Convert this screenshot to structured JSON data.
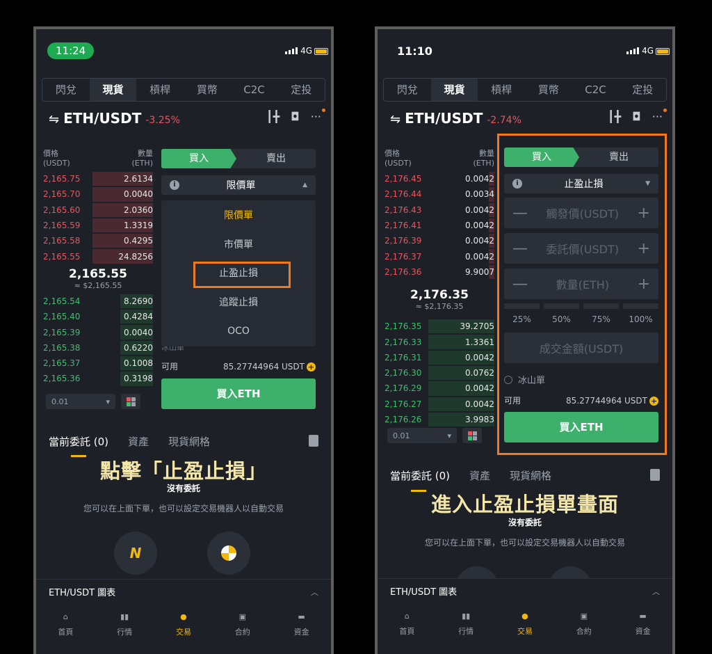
{
  "left": {
    "time": "11:24",
    "network": "4G",
    "tabs": [
      "閃兌",
      "現貨",
      "槓桿",
      "買幣",
      "C2C",
      "定投"
    ],
    "active_tab": 1,
    "pair": "ETH/USDT",
    "change": "-3.25%",
    "orderbook_header": {
      "price": "價格",
      "price_unit": "(USDT)",
      "qty": "數量",
      "qty_unit": "(ETH)"
    },
    "asks": [
      {
        "price": "2,165.75",
        "qty": "2.6134",
        "depth": 0.55
      },
      {
        "price": "2,165.70",
        "qty": "0.0040",
        "depth": 0.55
      },
      {
        "price": "2,165.60",
        "qty": "2.0360",
        "depth": 0.55
      },
      {
        "price": "2,165.59",
        "qty": "1.3319",
        "depth": 0.55
      },
      {
        "price": "2,165.58",
        "qty": "0.4295",
        "depth": 0.55
      },
      {
        "price": "2,165.55",
        "qty": "24.8256",
        "depth": 0.55
      }
    ],
    "last_price": "2,165.55",
    "last_price_usd": "≈ $2,165.55",
    "bids": [
      {
        "price": "2,165.54",
        "qty": "8.2690",
        "depth": 0.3
      },
      {
        "price": "2,165.40",
        "qty": "0.4284",
        "depth": 0.3
      },
      {
        "price": "2,165.39",
        "qty": "0.0040",
        "depth": 0.3
      },
      {
        "price": "2,165.38",
        "qty": "0.6220",
        "depth": 0.3
      },
      {
        "price": "2,165.37",
        "qty": "0.1008",
        "depth": 0.3
      },
      {
        "price": "2,165.36",
        "qty": "0.3198",
        "depth": 0.3
      }
    ],
    "precision": "0.01",
    "buy_label": "買入",
    "sell_label": "賣出",
    "order_type": "限價單",
    "dropdown": [
      "限價單",
      "市價單",
      "止盈止損",
      "追蹤止損",
      "OCO"
    ],
    "partial_text": "冰山單",
    "available_label": "可用",
    "available_value": "85.27744964 USDT",
    "buy_button": "買入ETH",
    "bottom_tabs": [
      "當前委託 (0)",
      "資產",
      "現貨網格"
    ],
    "caption": "點擊「止盈止損」",
    "no_orders": "沒有委託",
    "hint": "您可以在上面下單，也可以設定交易機器人以自動交易",
    "chart_label": "ETH/USDT 圖表",
    "nav": [
      "首頁",
      "行情",
      "交易",
      "合約",
      "資金"
    ],
    "nav_active": 2
  },
  "right": {
    "time": "11:10",
    "network": "4G",
    "tabs": [
      "閃兌",
      "現貨",
      "槓桿",
      "買幣",
      "C2C",
      "定投"
    ],
    "active_tab": 1,
    "pair": "ETH/USDT",
    "change": "-2.74%",
    "orderbook_header": {
      "price": "價格",
      "price_unit": "(USDT)",
      "qty": "數量",
      "qty_unit": "(ETH)"
    },
    "asks": [
      {
        "price": "2,176.45",
        "qty": "0.0042",
        "depth": 0.05
      },
      {
        "price": "2,176.44",
        "qty": "0.0034",
        "depth": 0.05
      },
      {
        "price": "2,176.43",
        "qty": "0.0042",
        "depth": 0.05
      },
      {
        "price": "2,176.41",
        "qty": "0.0042",
        "depth": 0.05
      },
      {
        "price": "2,176.39",
        "qty": "0.0042",
        "depth": 0.05
      },
      {
        "price": "2,176.37",
        "qty": "0.0042",
        "depth": 0.05
      },
      {
        "price": "2,176.36",
        "qty": "9.9007",
        "depth": 0.05
      }
    ],
    "last_price": "2,176.35",
    "last_price_usd": "≈ $2,176.35",
    "bids": [
      {
        "price": "2,176.35",
        "qty": "39.2705",
        "depth": 0.6
      },
      {
        "price": "2,176.33",
        "qty": "1.3361",
        "depth": 0.6
      },
      {
        "price": "2,176.31",
        "qty": "0.0042",
        "depth": 0.6
      },
      {
        "price": "2,176.30",
        "qty": "0.0762",
        "depth": 0.6
      },
      {
        "price": "2,176.29",
        "qty": "0.0042",
        "depth": 0.6
      },
      {
        "price": "2,176.27",
        "qty": "0.0042",
        "depth": 0.6
      },
      {
        "price": "2,176.26",
        "qty": "3.9983",
        "depth": 0.6
      }
    ],
    "precision": "0.01",
    "buy_label": "買入",
    "sell_label": "賣出",
    "order_type": "止盈止損",
    "trigger_placeholder": "觸發價(USDT)",
    "limit_placeholder": "委託價(USDT)",
    "amount_placeholder": "數量(ETH)",
    "percents": [
      "25%",
      "50%",
      "75%",
      "100%"
    ],
    "total_placeholder": "成交金額(USDT)",
    "iceberg": "冰山單",
    "available_label": "可用",
    "available_value": "85.27744964 USDT",
    "buy_button": "買入ETH",
    "bottom_tabs": [
      "當前委託 (0)",
      "資產",
      "現貨網格"
    ],
    "caption": "進入止盈止損單畫面",
    "no_orders": "沒有委託",
    "hint": "您可以在上面下單，也可以設定交易機器人以自動交易",
    "chart_label": "ETH/USDT 圖表",
    "nav": [
      "首頁",
      "行情",
      "交易",
      "合約",
      "資金"
    ],
    "nav_active": 2
  },
  "colors": {
    "accent": "#f0b90b",
    "buy": "#3db06b",
    "sell": "#e8565f",
    "highlight": "#f07a1e"
  }
}
